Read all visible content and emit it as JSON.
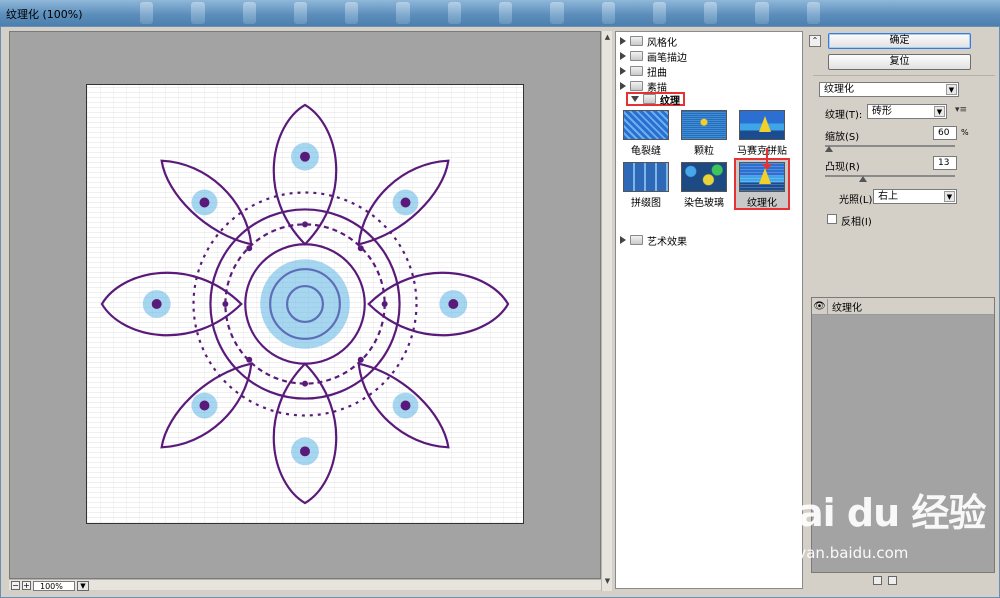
{
  "window": {
    "title": "纹理化 (100%)"
  },
  "preview": {
    "zoom": "100%"
  },
  "gallery": {
    "categories": [
      {
        "label": "风格化"
      },
      {
        "label": "画笔描边"
      },
      {
        "label": "扭曲"
      },
      {
        "label": "素描"
      },
      {
        "label": "纹理"
      },
      {
        "label": "艺术效果"
      }
    ],
    "thumbnails": [
      {
        "label": "龟裂缝"
      },
      {
        "label": "颗粒"
      },
      {
        "label": "马赛克拼贴"
      },
      {
        "label": "拼缀图"
      },
      {
        "label": "染色玻璃"
      },
      {
        "label": "纹理化"
      }
    ]
  },
  "buttons": {
    "ok": "确定",
    "reset": "复位"
  },
  "settings": {
    "filter_select": "纹理化",
    "texture_label": "纹理(T):",
    "texture_value": "砖形",
    "scale_label": "缩放(S)",
    "scale_value": "60",
    "scale_unit": "%",
    "relief_label": "凸现(R)",
    "relief_value": "13",
    "light_label": "光照(L):",
    "light_value": "右上",
    "invert_label": "反相(I)"
  },
  "layers": {
    "items": [
      {
        "label": "纹理化"
      }
    ]
  },
  "watermark": {
    "logo": "Bai du 经验",
    "url": "jingyan.baidu.com"
  },
  "colors": {
    "accent_red": "#e53333",
    "mandala_purple": "#5a1a7a",
    "mandala_blue": "#5fb4e6"
  }
}
